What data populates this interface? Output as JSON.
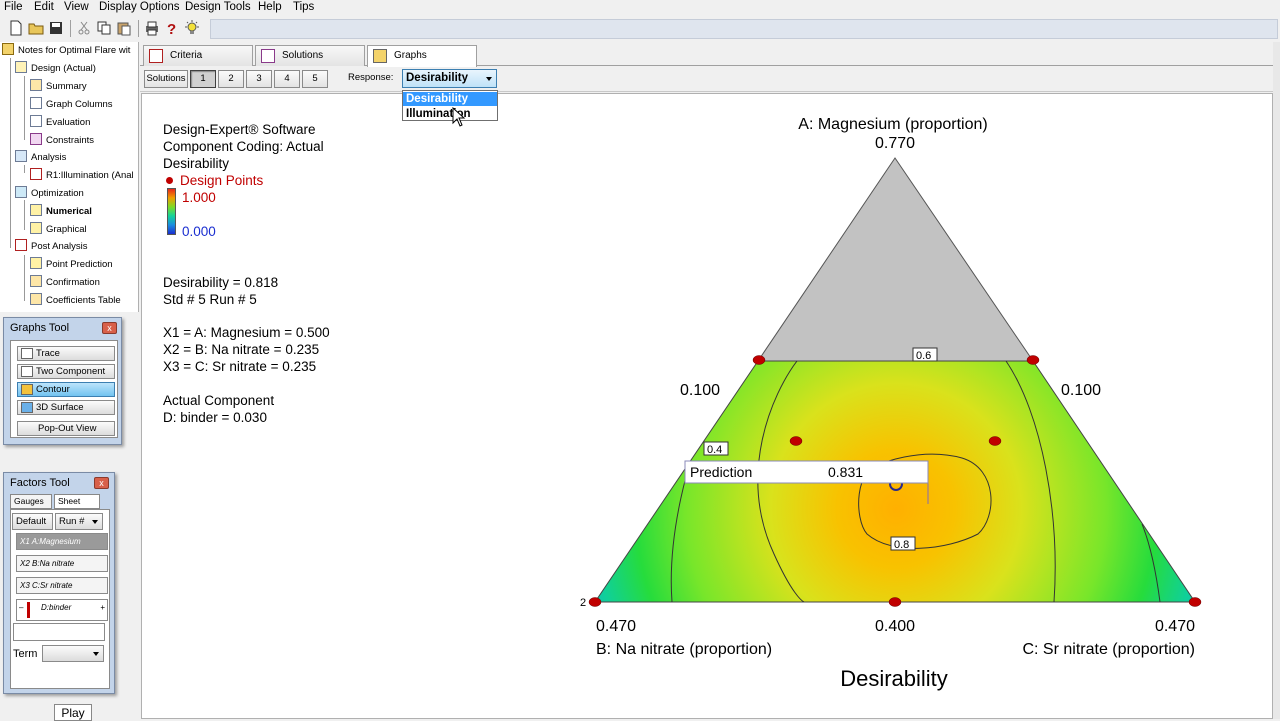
{
  "menu": [
    "File",
    "Edit",
    "View",
    "Display Options",
    "Design Tools",
    "Help",
    "Tips"
  ],
  "tree": {
    "root": "Notes for Optimal Flare wit",
    "items": [
      {
        "label": "Design (Actual)"
      },
      {
        "label": "Summary"
      },
      {
        "label": "Graph Columns"
      },
      {
        "label": "Evaluation"
      },
      {
        "label": "Constraints"
      },
      {
        "label": "Analysis"
      },
      {
        "label": "R1:Illumination (Anal"
      },
      {
        "label": "Optimization"
      },
      {
        "label": "Numerical"
      },
      {
        "label": "Graphical"
      },
      {
        "label": "Post Analysis"
      },
      {
        "label": "Point Prediction"
      },
      {
        "label": "Confirmation"
      },
      {
        "label": "Coefficients Table"
      }
    ]
  },
  "graphs_tool": {
    "title": "Graphs Tool",
    "buttons": [
      "Trace",
      "Two Component",
      "Contour",
      "3D Surface"
    ],
    "popout": "Pop-Out View"
  },
  "factors_tool": {
    "title": "Factors Tool",
    "tab_gauges": "Gauges",
    "tab_sheet": "Sheet",
    "default_btn": "Default",
    "run_select": "Run #",
    "factors": [
      "X1 A:Magnesium",
      "X2 B:Na nitrate",
      "X3 C:Sr nitrate"
    ],
    "slider_label": "D:binder",
    "slider_minus": "–",
    "slider_plus": "+",
    "term_label": "Term"
  },
  "play_label": "Play",
  "tabs": [
    "Criteria",
    "Solutions",
    "Graphs"
  ],
  "solutions": {
    "label": "Solutions",
    "numbers": [
      "1",
      "2",
      "3",
      "4",
      "5"
    ],
    "response_label": "Response:",
    "response_value": "Desirability",
    "dropdown_options": [
      "Desirability",
      "Illumination"
    ]
  },
  "info": {
    "software": "Design-Expert® Software",
    "coding": "Component Coding: Actual",
    "response": "Desirability",
    "design_points": "Design Points",
    "legend_high": "1.000",
    "legend_low": "0.000",
    "desirability": "Desirability = 0.818",
    "std_run": "Std # 5 Run # 5",
    "x1": "X1 = A: Magnesium = 0.500",
    "x2": "X2 = B: Na nitrate = 0.235",
    "x3": "X3 = C: Sr nitrate = 0.235",
    "actual_component": "Actual Component",
    "binder": "D: binder = 0.030"
  },
  "plot": {
    "axis_a": "A: Magnesium (proportion)",
    "apex_value": "0.770",
    "left_value": "0.100",
    "right_value": "0.100",
    "bottom_left_value": "0.470",
    "bottom_mid_value": "0.400",
    "bottom_right_value": "0.470",
    "axis_b": "B: Na nitrate (proportion)",
    "axis_c": "C: Sr nitrate (proportion)",
    "title": "Desirability",
    "contour_labels": [
      "0.6",
      "0.4",
      "0.8"
    ],
    "prediction_label": "Prediction",
    "prediction_value": "0.831",
    "point_count_label": "2"
  },
  "colors": {
    "accent": "#3399ff",
    "design_point": "#c00000",
    "optimum": "#f5a300"
  }
}
